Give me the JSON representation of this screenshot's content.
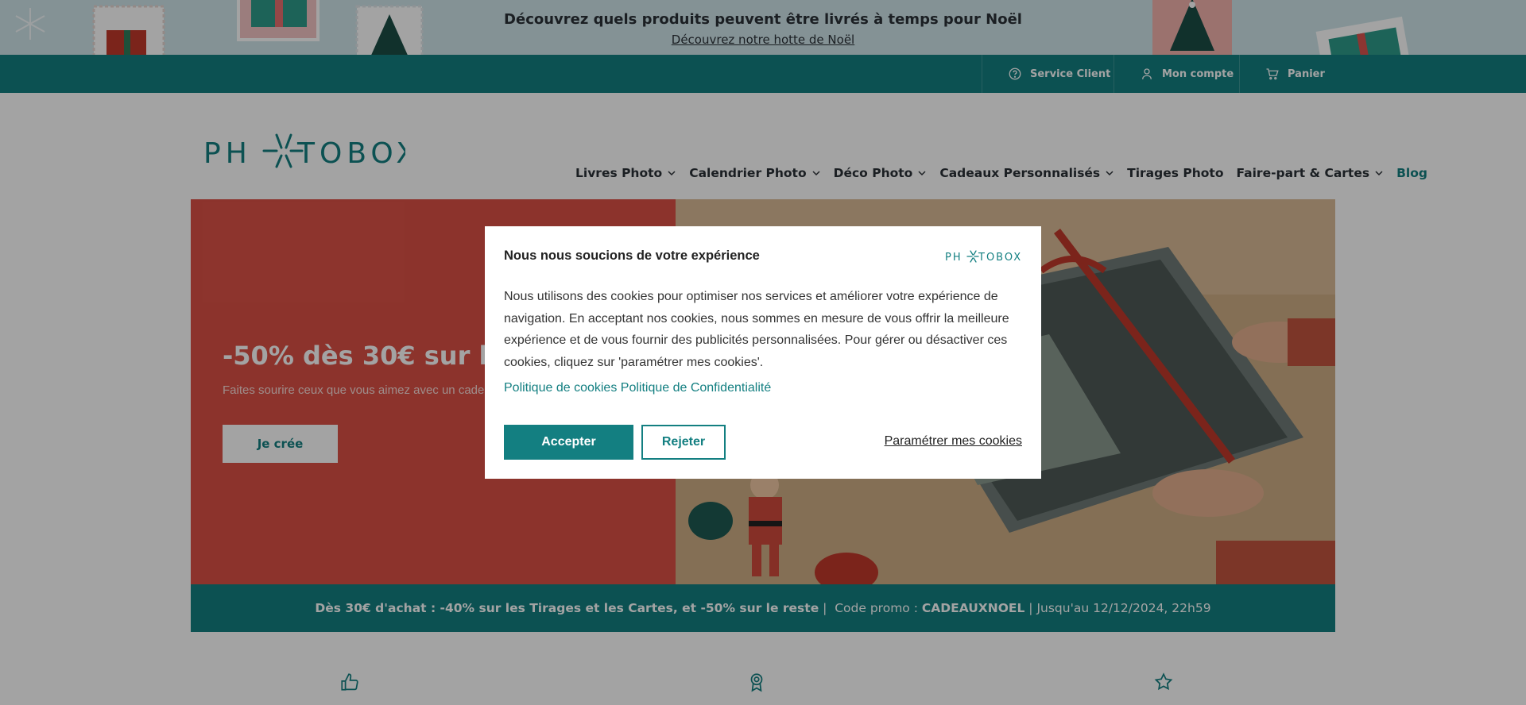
{
  "announcement": {
    "title": "Découvrez quels produits peuvent être livrés à temps pour Noël",
    "link": "Découvrez notre hotte de Noël"
  },
  "utility_bar": {
    "items": [
      {
        "label": "Service Client",
        "icon": "help-circle-icon"
      },
      {
        "label": "Mon compte",
        "icon": "user-icon"
      },
      {
        "label": "Panier",
        "icon": "cart-icon"
      }
    ]
  },
  "header": {
    "logo_text": "PH✳TOBOX",
    "nav": [
      {
        "label": "Livres Photo",
        "dropdown": true
      },
      {
        "label": "Calendrier Photo",
        "dropdown": true
      },
      {
        "label": "Déco Photo",
        "dropdown": true
      },
      {
        "label": "Cadeaux Personnalisés",
        "dropdown": true
      },
      {
        "label": "Tirages Photo",
        "dropdown": false
      },
      {
        "label": "Faire-part & Cartes",
        "dropdown": true
      },
      {
        "label": "Blog",
        "dropdown": false
      }
    ]
  },
  "hero": {
    "title": "-50% dès 30€ sur les Li",
    "subtitle": "Faites sourire ceux que vous aimez avec un cade",
    "button": "Je crée"
  },
  "promo": {
    "offer": "Dès 30€ d'achat : -40% sur les Tirages et les Cartes, et -50% sur le reste",
    "code_label": "Code promo :",
    "code": "CADEAUXNOEL",
    "until": "Jusqu'au 12/12/2024, 22h59"
  },
  "cookie_modal": {
    "title": "Nous nous soucions de votre expérience",
    "body": "Nous utilisons des cookies pour optimiser nos services et améliorer votre expérience de navigation. En acceptant nos cookies, nous sommes en mesure de vous offrir la meilleure expérience et de vous fournir des publicités personnalisées. Pour gérer ou désactiver ces cookies, cliquez sur 'paramétrer mes cookies'.",
    "link_cookies": "Politique de cookies",
    "link_privacy": "Politique de Confidentialité",
    "accept": "Accepter",
    "reject": "Rejeter",
    "settings": "Paramétrer mes cookies"
  },
  "colors": {
    "brand_teal": "#137f81",
    "hero_red": "#dc5146",
    "banner_bg": "#cfe5ea"
  },
  "bottom_icons": [
    "thumbs-up-icon",
    "award-ribbon-icon",
    "star-icon"
  ]
}
